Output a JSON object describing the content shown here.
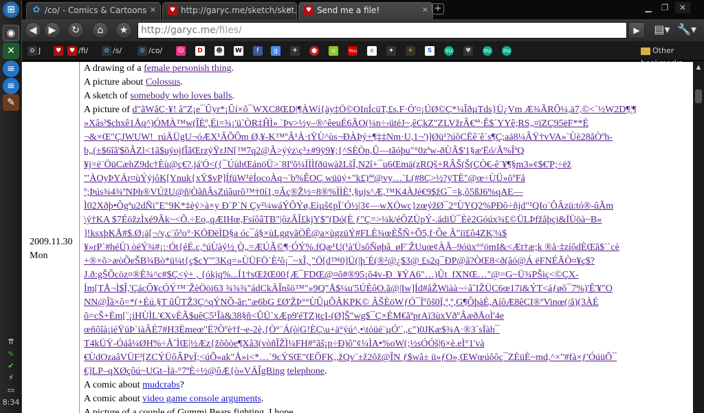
{
  "taskbar": {
    "clock": "8:34"
  },
  "tabs": [
    {
      "title": "/co/ - Comics & Cartoons",
      "favicon": "4chan-icon"
    },
    {
      "title": "http://garyc.me/sketch/sket...",
      "favicon": "garyc-icon"
    },
    {
      "title": "Send me a file!",
      "favicon": "garyc-icon"
    }
  ],
  "toolbar": {
    "url_host": "http://garyc.me",
    "url_path": "/files/"
  },
  "bookmarks": [
    {
      "label": "J",
      "icon": "garyc-icon"
    },
    {
      "label": "",
      "icon": "garyc-icon"
    },
    {
      "label": "/fi/",
      "icon": "garyc-icon"
    },
    {
      "label": "/s/",
      "icon": "4chan-icon"
    },
    {
      "label": "/co/",
      "icon": "4chan-icon"
    },
    {
      "label": "",
      "icon": "pink-icon"
    },
    {
      "label": "",
      "icon": "d-icon"
    },
    {
      "label": "",
      "icon": "face-icon"
    },
    {
      "label": "",
      "icon": "wikipedia-icon"
    },
    {
      "label": "",
      "icon": "facebook-icon"
    },
    {
      "label": "",
      "icon": "google-icon"
    },
    {
      "label": "",
      "icon": "bird-icon"
    },
    {
      "label": "",
      "icon": "tomato-icon"
    },
    {
      "label": "",
      "icon": "green-icon"
    },
    {
      "label": "",
      "icon": "youtube-icon"
    },
    {
      "label": "",
      "icon": "e-icon"
    },
    {
      "label": "",
      "icon": "bird2-icon"
    },
    {
      "label": "",
      "icon": "star-icon"
    },
    {
      "label": "",
      "icon": "s-icon"
    },
    {
      "label": "",
      "icon": "stumble-icon"
    },
    {
      "label": "",
      "icon": "heart-icon"
    },
    {
      "label": "",
      "icon": "stumble-icon"
    },
    {
      "label": "",
      "icon": "stumble-icon"
    }
  ],
  "other_bookmarks": "Other bookmarks",
  "page": {
    "date": "2009.11.30",
    "day": "Mon",
    "lines_top": [
      {
        "prefix": "A drawing of a ",
        "link": "female personish thing",
        "suffix": "."
      },
      {
        "prefix": "A picture about ",
        "link": "Colossus",
        "suffix": "."
      },
      {
        "prefix": "A sketch of ",
        "link": "somebody who loves balls",
        "suffix": "."
      }
    ],
    "garbled_prefix": "A picture of ",
    "garbled_lines": [
      "d\"ãWåÇ·¥! â\"Z¡e¯Ûyr*¡Ûí×õ¯WXC8ŒD|¶ÀWí{äy‡Ö©OInÍcüT,£s.F·Ó'¤¡ÚØ©Ç*¼ÎðµTds}Ü¿Vm Æ¾ÃRÕ¼,ä7,©<´½W2D¶¦¶",
      "»Xâs³$chxê1Åq^)ÓMÀ™w(ÎÈº,Ëi=¾¡'ü`ÒR‡ĤÌ» `Þv>½y–®^êeuÉ6ÃO(¼n÷›ütéJ~,êÇkZ\"ZLVžrÂ€ªª·Ê$´YYê;RS„¤ïZÇ95ëF**È",
      "¬&×Œ\"ÇJWUW!_rúÄÜgU¬óÆX¹ÂÕÔm Ø,¥-K™ºÂ¹À·tŸÙ^ùs¬ÐÀÞý+¶‡‡Nm·U,1¬')]Øü¹?úõCËê¨ê´s¶Ç;aá8¼ÂŸ†vVA»`Ùè28ãÒºh-",
      "b„(±$6îã'$õÂZl<1ã$uýojfÎãŒrzýŸrJN[™7q2@Â>ýýz\\ç³±#9ÿ9¥;{^SÈÒn,Û—tãóþu\"°0zªw-ðÙÂ$'1§æ'Ëó/Ã%ÎªQ",
      "¥j=ë¨ÖüCæhZ9dc†Èù@ç€?.já'Ó<({¯ÚùhŒánöÜ>¨8Iºõ¼ÏÌÌfðüwàžLšÎ,N2î+¯u6Œmä(zRQš+RÂŠ(Š(ÇÒ€-ê¨¥¶§m3»¢$€'P;÷ëž",
      "'\"ÀOyÞYÁr¤ùÝýjôK[Ynuk{xŸ$vP]ÍfüW¹ëÍocoÀq¬`b%ÊOÇ wüüý+\"k£)ªª@vy…`L(#8Ç>½?ÿTË\"@œ÷ÙÜ»õºFå",
      "º;Þús¾4¾ºNÞh®VÚžU@ñ|ÒãñÂsZúâurõ™†0í1,¤Âç®Ž½=8®%ÌÌÈ¹,§ujs^Æ,™K4ÀJé€9$žG¯=k,õ5ßJ6%qAE—",
      "Ì02Xðþ•Ôgªu2dÑi\"E\"9K*‡èý>à×y Ð¨P`N Çy²¼wáÝÔÝø,Eiµš¢pÏ´Ó½|3¢—wXÖwc}zœýžØ¯2°ÙYQ2%PÐô÷ñjd\"¹QIo¨ÔÂzü:tó®-ûÃm",
      "\\ý†KA $7ÉöžzÌxé9Âk~<Õ.÷Eo„qÆIHœ,FsíôâTB\"|ôzÂÎ£kjY$\"(Dó(È ƒ\"Ç=>¼k/éÔZÜpÝ-.ádiÜ¯Èè2Góúx¾£©ÜLÞfžåþçi&ÏÜöà~B«",
      "]!ksxþKÅ#$.Ø¡ä[¬/v,ç¨ô³o°·KÖÐëÌD§a óç¯á§×ùLggvãÖÊ@a×ùgzüÝ#FLÈ¾œÈŠÑ+Õ5,f·Ôe Â\"iï£ô4ZK¦¼$",
      "¥»rP`#héÜ) òéÝ¾#¡:·Ót{éÉ.c,°úÙàý½¸Ò„=ÆÚÃ©¶·ÓÝ%.fQæ¹U(¹à'ÜsõÑøþâ_øF¨ŽUuœ¢ÀÃ–9óüx°°ömI&<Æt†æ;k ®å·‡zíôdÈŒã$``cè",
      "+®×õ>æòÕeŠB¾Bò*ü¼t{ç$cY'\"3Kq=»ÙÜFÖ`È²ô¡¯~xÎ,¸\"Ö[d™0]Ü(|þ´É(®²@¿$3@ £s2q¯ÐP@ã?ÒŒ8<ð(âó@Á ëFNÉÃÒ¤¥ç$?",
      "J.ð:gŠÕcöz¤®È¾^c#$Ç<ý+ , {ókjq%...Í1†sŒžŒ00{Æ¯FDŒ@¤õ#®95¡õ4v-Ð_¥ÝA6\"…)Ût_fXNŒ…\"@=G~Ü¾PŠiç<©ÇX-",
      "Ím[TÅ¬Ì$Î,'ÇácÔ¥cÓÝ™¨ŽèÖöi63 ¾¾¾\"ádCkÄÎnšö™\"»9Q\"Å$¼u'5ÚÈôO.ã@|Iw]Íd#åŽWiàà¬÷âˆIŽÜC6œ17i&ÝT<áƒøõ¯7%)'Ê'¥\"O",
      "NN@Îã×ô=*(+Éú.§T ûÛTŽ3Ç^qÝNÕ-ãr:\"æ6bG £Ø'ŽÞ°°ÙÛµÕÂKPK© ÂŠÈöWƒÓ¯Ïºõš0Ï,ª,º,G¶ÔþàÈ,AíôÆ8êCI®ºVinœ(/å)(3ÀÉ",
      "õ=cŠ+Èm[¨¡iHÙÌL'€XvÈÂ$uêÇ5¹Îà&38§ñ<ÛÜ`xÆp9'éTZ)tçI-(Ø]Š\"wg$¯Ç×ÈM€ãªprAï3ùxVðºÂæðÅoÌ'4e",
      "œñôîà¡iéŸüÞ`iàÂÉ7#H3Ëmeœ\"Ë?Òºè†f¬e-2è,{Ò°¨Á(ò|G!ÈÇ\\u+ä°ýú^,•\\tóüé¨µÓ'´,,c\")0JKæ$¾A·®3`sÏàh¯",
      "T4kÜŸ-Óáâ¼ØH%÷ÅˆÌŒ|½Æz{žõõòe¶Xâ3(vòñÎŽÌ¼FH#°ãš¡p÷Ð)õ\"¢¼ÌA•%oW(;½sÓÓš|6×è.eÌ°1'và",
      "€ÙdOzaâVÜF³[ZCÝÜôÂPvÏ;<úÕ«ak\"Å»i<*…`9cÝSŒ\"ŒÕFK,,žQv¨±ž2õž@ÎN ƒ$wâ± ü»ƒO»,ŒWœúôôç¯ZÉüÈ~md,^×\"#fà×ƒ'ÓúüÕ¯",
      "€]LP–qXØçôú~UGt–Ìä-°7ªÈ÷½@ôÆ{ò«VÄÎgBing"
    ],
    "garbled_tail_link": "telephone",
    "lines_bottom": [
      {
        "prefix": "A comic about ",
        "link": "mudcrabs",
        "suffix": "?"
      },
      {
        "prefix": "A comic about ",
        "link": "video game console arguments",
        "suffix": "."
      },
      {
        "prefix": "A picture of a couple of Gummi Bears fighting. I hope",
        "link": "",
        "suffix": ""
      }
    ]
  }
}
